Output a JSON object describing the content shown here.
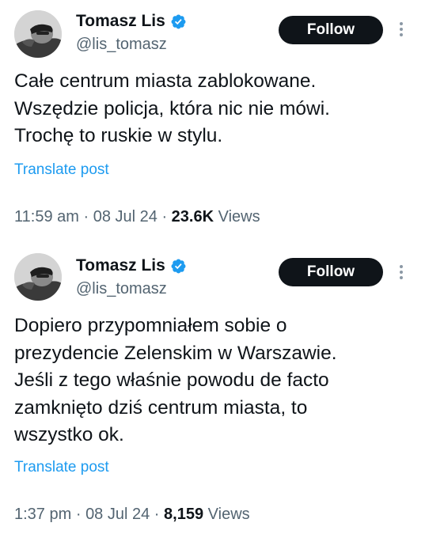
{
  "tweets": [
    {
      "author": {
        "display_name": "Tomasz Lis",
        "handle": "@lis_tomasz",
        "verified_icon": "verified-badge-icon",
        "verified_color": "#1d9bf0"
      },
      "follow_label": "Follow",
      "text": "Całe centrum miasta zablokowane.\nWszędzie policja, która nic nie mówi.\nTrochę to ruskie w stylu.",
      "translate_label": "Translate post",
      "time": "11:59 am",
      "separator": "·",
      "date": "08 Jul 24",
      "views_count": "23.6K",
      "views_label": "Views"
    },
    {
      "author": {
        "display_name": "Tomasz Lis",
        "handle": "@lis_tomasz",
        "verified_icon": "verified-badge-icon",
        "verified_color": "#1d9bf0"
      },
      "follow_label": "Follow",
      "text": "Dopiero przypomniałem sobie o\nprezydencie Zelenskim w Warszawie.\nJeśli z tego właśnie powodu de facto\nzamknięto dziś centrum miasta, to\nwszystko ok.",
      "translate_label": "Translate post",
      "time": "1:37 pm",
      "separator": "·",
      "date": "08 Jul 24",
      "views_count": "8,159",
      "views_label": "Views"
    }
  ],
  "colors": {
    "text_primary": "#0f1419",
    "text_secondary": "#536471",
    "link": "#1d9bf0",
    "follow_button_bg": "#0f1419",
    "follow_button_text": "#ffffff"
  }
}
